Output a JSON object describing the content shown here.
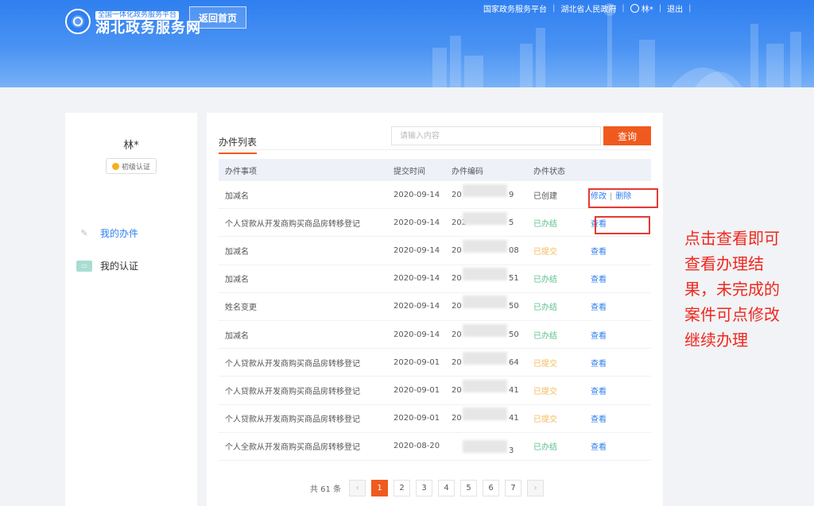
{
  "header": {
    "logo_sub": "全国一体化政务服务平台",
    "logo_main": "湖北政务服务网",
    "home_button": "返回首页",
    "nav": {
      "national_platform": "国家政务服务平台",
      "provincial_gov": "湖北省人民政府",
      "username": "林*",
      "logout": "退出"
    }
  },
  "sidebar": {
    "name": "林*",
    "badge": "初级认证",
    "items": [
      {
        "label": "我的办件",
        "icon": "pen-icon"
      },
      {
        "label": "我的认证",
        "icon": "certificate-icon"
      }
    ]
  },
  "main": {
    "title": "办件列表",
    "search": {
      "placeholder": "请输入内容",
      "button": "查询"
    },
    "columns": [
      "办件事项",
      "提交时间",
      "办件编码",
      "办件状态"
    ],
    "rows": [
      {
        "item": "加减名",
        "date": "2020-09-14",
        "code_prefix": "20",
        "code_suffix": "9",
        "status": "已创建",
        "status_type": "created",
        "actions": [
          "修改",
          "删除"
        ]
      },
      {
        "item": "个人贷款从开发商购买商品房转移登记",
        "date": "2020-09-14",
        "code_prefix": "202",
        "code_suffix": "5",
        "status": "已办结",
        "status_type": "done",
        "actions": [
          "查看"
        ]
      },
      {
        "item": "加减名",
        "date": "2020-09-14",
        "code_prefix": "20",
        "code_suffix": "08",
        "status": "已提交",
        "status_type": "submitted",
        "actions": [
          "查看"
        ]
      },
      {
        "item": "加减名",
        "date": "2020-09-14",
        "code_prefix": "20",
        "code_suffix": "51",
        "status": "已办结",
        "status_type": "done",
        "actions": [
          "查看"
        ]
      },
      {
        "item": "姓名变更",
        "date": "2020-09-14",
        "code_prefix": "20",
        "code_suffix": "50",
        "status": "已办结",
        "status_type": "done",
        "actions": [
          "查看"
        ]
      },
      {
        "item": "加减名",
        "date": "2020-09-14",
        "code_prefix": "20",
        "code_suffix": "50",
        "status": "已办结",
        "status_type": "done",
        "actions": [
          "查看"
        ]
      },
      {
        "item": "个人贷款从开发商购买商品房转移登记",
        "date": "2020-09-01",
        "code_prefix": "20",
        "code_suffix": "64",
        "status": "已提交",
        "status_type": "submitted",
        "actions": [
          "查看"
        ]
      },
      {
        "item": "个人贷款从开发商购买商品房转移登记",
        "date": "2020-09-01",
        "code_prefix": "20",
        "code_suffix": "41",
        "status": "已提交",
        "status_type": "submitted",
        "actions": [
          "查看"
        ]
      },
      {
        "item": "个人贷款从开发商购买商品房转移登记",
        "date": "2020-09-01",
        "code_prefix": "20",
        "code_suffix": "41",
        "status": "已提交",
        "status_type": "submitted",
        "actions": [
          "查看"
        ]
      },
      {
        "item": "个人全款从开发商购买商品房转移登记",
        "date": "2020-08-20",
        "code_prefix": "",
        "code_suffix": "3",
        "status": "已办结",
        "status_type": "done",
        "actions": [
          "查看"
        ]
      }
    ],
    "pagination": {
      "total_text": "共 61 条",
      "prev": "‹",
      "next": "›",
      "pages": [
        "1",
        "2",
        "3",
        "4",
        "5",
        "6",
        "7"
      ],
      "current": "1"
    }
  },
  "annotation": {
    "lines": [
      "点击查看即可",
      "查看办理结",
      "果，未完成的",
      "案件可点修改",
      "继续办理"
    ]
  },
  "colors": {
    "header_blue": "#2f7ff0",
    "accent_orange": "#f05a1e",
    "status_done": "#5ac18e",
    "status_submitted": "#f5b95a",
    "link_blue": "#2f7ff0",
    "annotation_red": "#f0281e"
  }
}
